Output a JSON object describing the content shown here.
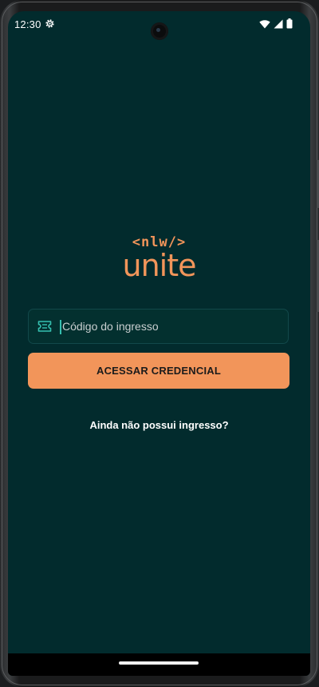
{
  "status_bar": {
    "time": "12:30",
    "left_icons": [
      "gear-icon"
    ],
    "right_icons": [
      "wifi-icon",
      "signal-icon",
      "battery-icon"
    ]
  },
  "logo": {
    "tag": "<nlw/>",
    "word": "unite"
  },
  "ticket_input": {
    "icon": "ticket-icon",
    "placeholder": "Código do ingresso",
    "value": ""
  },
  "primary_button": {
    "label": "ACESSAR CREDENCIAL"
  },
  "secondary_link": {
    "label": "Ainda não possui ingresso?"
  },
  "colors": {
    "background": "#022b2d",
    "accent": "#f2955a",
    "input_border": "#12484a",
    "icon_green": "#35c0b0"
  }
}
